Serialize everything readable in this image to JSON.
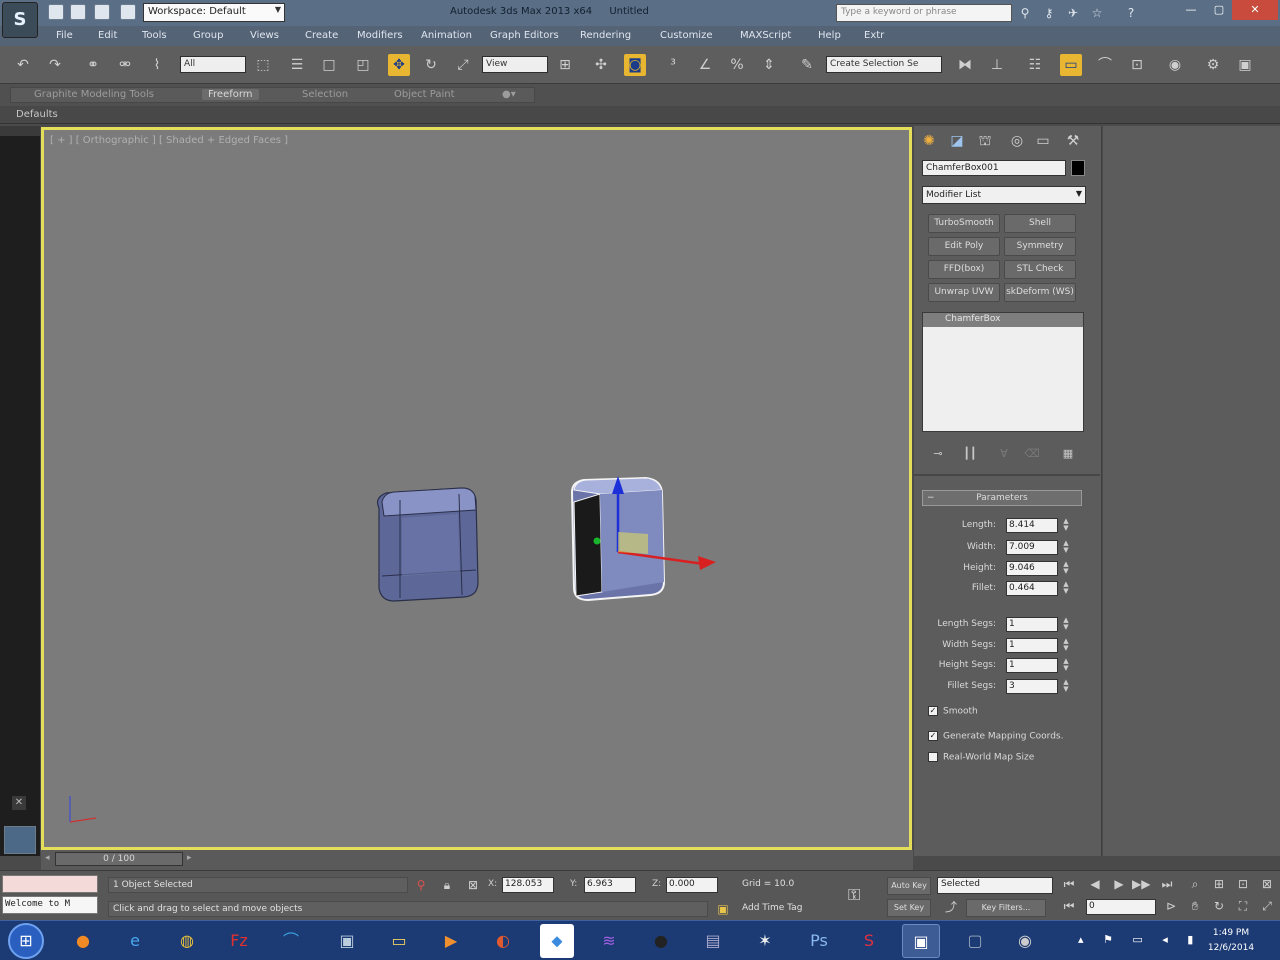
{
  "title_bar": {
    "workspace": "Workspace: Default",
    "app_name": "Autodesk 3ds Max 2013 x64",
    "file_name": "Untitled",
    "search_placeholder": "Type a keyword or phrase"
  },
  "menu": [
    "File",
    "Edit",
    "Tools",
    "Group",
    "Views",
    "Create",
    "Modifiers",
    "Animation",
    "Graph Editors",
    "Rendering",
    "Customize",
    "MAXScript",
    "Help",
    "Extr"
  ],
  "toolbar": {
    "selection_filter": "All",
    "reference_coord": "View",
    "named_selection_placeholder": "Create Selection Se"
  },
  "ribbon": {
    "tabs": [
      "Graphite Modeling Tools",
      "Freeform",
      "Selection",
      "Object Paint"
    ],
    "active_tab": 1,
    "sub_label": "Defaults"
  },
  "viewport": {
    "label": "[ + ] [ Orthographic ] [ Shaded + Edged Faces ]",
    "frame_color": "#e4de5a",
    "background": "#7b7b7b"
  },
  "command_panel": {
    "object_name": "ChamferBox001",
    "object_color": "#000000",
    "modifier_list": "Modifier List",
    "modifier_buttons": [
      "TurboSmooth",
      "Shell",
      "Edit Poly",
      "Symmetry",
      "FFD(box)",
      "STL Check",
      "Unwrap UVW",
      "skDeform (WS)"
    ],
    "stack_items": [
      "ChamferBox"
    ],
    "parameters": {
      "header": "Parameters",
      "fields": [
        {
          "label": "Length:",
          "value": "8.414"
        },
        {
          "label": "Width:",
          "value": "7.009"
        },
        {
          "label": "Height:",
          "value": "9.046"
        },
        {
          "label": "Fillet:",
          "value": "0.464"
        }
      ],
      "segments": [
        {
          "label": "Length Segs:",
          "value": "1"
        },
        {
          "label": "Width Segs:",
          "value": "1"
        },
        {
          "label": "Height Segs:",
          "value": "1"
        },
        {
          "label": "Fillet Segs:",
          "value": "3"
        }
      ],
      "checkboxes": [
        {
          "label": "Smooth",
          "checked": true
        },
        {
          "label": "Generate Mapping Coords.",
          "checked": true
        },
        {
          "label": "Real-World Map Size",
          "checked": false
        }
      ]
    }
  },
  "timeline": {
    "slider": "0 / 100",
    "current_frame": 0,
    "total_frames": 100
  },
  "status_bar": {
    "maxscript_listener": "Welcome to M",
    "selected": "1 Object Selected",
    "prompt": "Click and drag to select and move objects",
    "x_label": "X:",
    "x": "128.053",
    "y_label": "Y:",
    "y": "6.963",
    "z_label": "Z:",
    "z": "0.000",
    "grid": "Grid = 10.0",
    "add_time_tag": "Add Time Tag",
    "auto_key": "Auto Key",
    "set_key": "Set Key",
    "key_mode": "Selected",
    "key_filters": "Key Filters...",
    "frame": "0"
  },
  "taskbar": {
    "apps": [
      "windows-media-player",
      "firefox",
      "internet-explorer",
      "chrome",
      "filezilla",
      "app-arc",
      "app-photos",
      "file-explorer",
      "media-player",
      "app-red",
      "dropbox",
      "app-purple",
      "app-avatar",
      "app-window",
      "app-figure",
      "photoshop",
      "app-s",
      "3ds-max",
      "app-blue",
      "app-round"
    ],
    "time": "1:49 PM",
    "date": "12/6/2014"
  }
}
